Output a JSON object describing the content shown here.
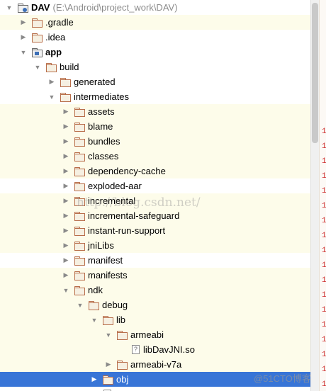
{
  "project_tree": {
    "rows": [
      {
        "label": "DAV",
        "path": "(E:\\Android\\project_work\\DAV)",
        "depth": 0,
        "arrow": "open",
        "icon": "root-folder-icon",
        "bold": true,
        "highlight": false
      },
      {
        "label": ".gradle",
        "depth": 1,
        "arrow": "closed",
        "icon": "folder-icon",
        "highlight": true
      },
      {
        "label": ".idea",
        "depth": 1,
        "arrow": "closed",
        "icon": "folder-icon",
        "highlight": false
      },
      {
        "label": "app",
        "depth": 1,
        "arrow": "open",
        "icon": "module-folder-icon",
        "bold": true,
        "highlight": false
      },
      {
        "label": "build",
        "depth": 2,
        "arrow": "open",
        "icon": "folder-icon",
        "highlight": false
      },
      {
        "label": "generated",
        "depth": 3,
        "arrow": "closed",
        "icon": "folder-icon",
        "highlight": false
      },
      {
        "label": "intermediates",
        "depth": 3,
        "arrow": "open",
        "icon": "folder-icon",
        "highlight": false
      },
      {
        "label": "assets",
        "depth": 4,
        "arrow": "closed",
        "icon": "folder-icon",
        "highlight": true
      },
      {
        "label": "blame",
        "depth": 4,
        "arrow": "closed",
        "icon": "folder-icon",
        "highlight": true
      },
      {
        "label": "bundles",
        "depth": 4,
        "arrow": "closed",
        "icon": "folder-icon",
        "highlight": true
      },
      {
        "label": "classes",
        "depth": 4,
        "arrow": "closed",
        "icon": "folder-icon",
        "highlight": true
      },
      {
        "label": "dependency-cache",
        "depth": 4,
        "arrow": "closed",
        "icon": "folder-icon",
        "highlight": true
      },
      {
        "label": "exploded-aar",
        "depth": 4,
        "arrow": "closed",
        "icon": "folder-icon",
        "highlight": false
      },
      {
        "label": "incremental",
        "depth": 4,
        "arrow": "closed",
        "icon": "folder-icon",
        "highlight": true
      },
      {
        "label": "incremental-safeguard",
        "depth": 4,
        "arrow": "closed",
        "icon": "folder-icon",
        "highlight": true
      },
      {
        "label": "instant-run-support",
        "depth": 4,
        "arrow": "closed",
        "icon": "folder-icon",
        "highlight": true
      },
      {
        "label": "jniLibs",
        "depth": 4,
        "arrow": "closed",
        "icon": "folder-icon",
        "highlight": true
      },
      {
        "label": "manifest",
        "depth": 4,
        "arrow": "closed",
        "icon": "folder-icon",
        "highlight": false
      },
      {
        "label": "manifests",
        "depth": 4,
        "arrow": "closed",
        "icon": "folder-icon",
        "highlight": true
      },
      {
        "label": "ndk",
        "depth": 4,
        "arrow": "open",
        "icon": "folder-icon",
        "highlight": true
      },
      {
        "label": "debug",
        "depth": 5,
        "arrow": "open",
        "icon": "folder-icon",
        "highlight": true
      },
      {
        "label": "lib",
        "depth": 6,
        "arrow": "open",
        "icon": "folder-icon",
        "highlight": true
      },
      {
        "label": "armeabi",
        "depth": 7,
        "arrow": "open",
        "icon": "folder-icon",
        "highlight": true
      },
      {
        "label": "libDavJNI.so",
        "depth": 8,
        "arrow": "none",
        "icon": "unknown-file-icon",
        "highlight": true
      },
      {
        "label": "armeabi-v7a",
        "depth": 7,
        "arrow": "closed",
        "icon": "folder-icon",
        "highlight": true
      },
      {
        "label": "obj",
        "depth": 6,
        "arrow": "closed",
        "icon": "folder-icon",
        "highlight": false,
        "selected": true
      },
      {
        "label": "",
        "depth": 6,
        "arrow": "none",
        "icon": "unknown-file-icon",
        "highlight": false
      }
    ]
  },
  "gutter": {
    "marks": [
      "1",
      "1",
      "1",
      "1",
      "1",
      "1",
      "1",
      "1",
      "1",
      "1",
      "1",
      "1",
      "1",
      "1",
      "1",
      "1",
      "1",
      "1"
    ]
  },
  "watermark": {
    "text": "http://blog.csdn.net/",
    "corner_text": "@51CTO博客"
  },
  "colors": {
    "selection": "#3875d7",
    "highlight_row": "#fdfcea",
    "folder_stroke": "#b86e4a",
    "gutter_mark": "#cc2a2a"
  }
}
